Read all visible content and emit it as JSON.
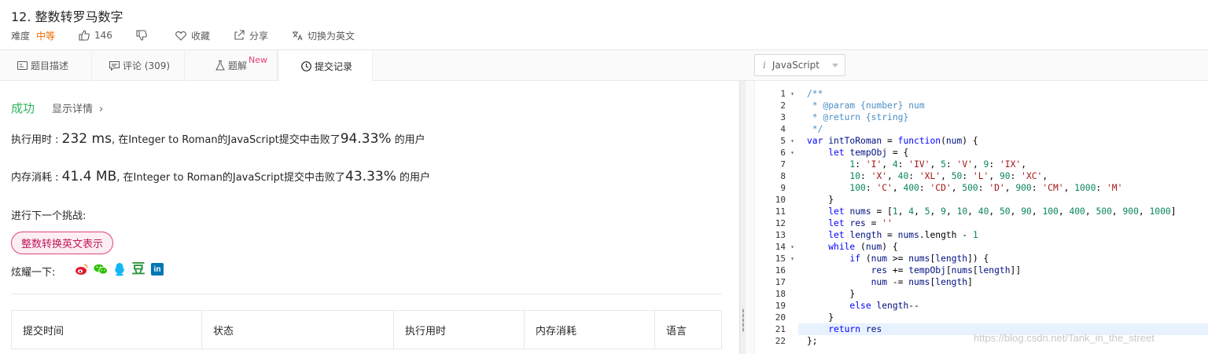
{
  "problem": {
    "title": "12. 整数转罗马数字",
    "difficulty_label": "难度",
    "difficulty": "中等",
    "likes": "146",
    "favorite": "收藏",
    "share": "分享",
    "switch_lang": "切换为英文"
  },
  "tabs": [
    {
      "label": "题目描述"
    },
    {
      "label": "评论 (309)"
    },
    {
      "label": "题解",
      "badge": "New"
    },
    {
      "label": "提交记录"
    }
  ],
  "result": {
    "status": "成功",
    "details": "显示详情",
    "runtime_prefix": "执行用时 : ",
    "runtime_value": "232 ms",
    "runtime_mid": ", 在Integer to Roman的JavaScript提交中击败了",
    "runtime_pct": "94.33%",
    "runtime_suffix": " 的用户",
    "memory_prefix": "内存消耗 : ",
    "memory_value": "41.4 MB",
    "memory_mid": ", 在Integer to Roman的JavaScript提交中击败了",
    "memory_pct": "43.33%",
    "memory_suffix": " 的用户",
    "next_challenge_label": "进行下一个挑战:",
    "next_challenge": "整数转换英文表示",
    "share_label": "炫耀一下:",
    "share_icons": [
      "weibo-icon",
      "wechat-icon",
      "qq-icon",
      "douban-icon",
      "linkedin-icon"
    ],
    "share_icon_text": {
      "douban": "豆",
      "linkedin": "in"
    }
  },
  "table": {
    "headers": [
      "提交时间",
      "状态",
      "执行用时",
      "内存消耗",
      "语言"
    ]
  },
  "editor": {
    "language": "JavaScript",
    "language_prefix": "i",
    "highlighted_line": 21,
    "line_numbers": [
      "1",
      "2",
      "3",
      "4",
      "5",
      "6",
      "7",
      "8",
      "9",
      "10",
      "11",
      "12",
      "13",
      "14",
      "15",
      "16",
      "17",
      "18",
      "19",
      "20",
      "21",
      "22"
    ],
    "fold_lines": [
      1,
      5,
      6,
      14,
      15
    ]
  },
  "watermark": "https://blog.csdn.net/Tank_in_the_street",
  "colors": {
    "success": "#2db55d",
    "medium": "#ef6c00",
    "badge": "#e5417a"
  }
}
